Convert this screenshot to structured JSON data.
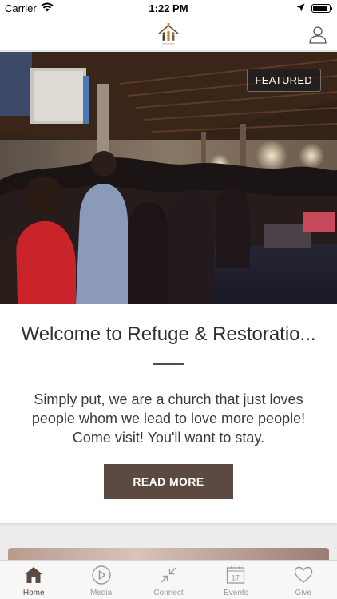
{
  "status_bar": {
    "carrier": "Carrier",
    "time": "1:22 PM",
    "battery_level": 0.9
  },
  "nav": {
    "logo_icon": "church-logo-icon",
    "profile_icon": "user-icon"
  },
  "featured": {
    "badge": "FEATURED",
    "title": "Welcome to Refuge & Restoratio...",
    "body": "Simply put, we are a church that just loves people whom we lead to love more people! Come visit! You'll want to stay.",
    "button_label": "READ MORE"
  },
  "tabs": [
    {
      "label": "Home",
      "icon": "home-icon",
      "active": true
    },
    {
      "label": "Media",
      "icon": "play-icon",
      "active": false
    },
    {
      "label": "Connect",
      "icon": "connect-arrows-icon",
      "active": false
    },
    {
      "label": "Events",
      "icon": "calendar-icon",
      "active": false,
      "date": "17"
    },
    {
      "label": "Give",
      "icon": "heart-icon",
      "active": false
    }
  ],
  "colors": {
    "accent": "#5c4a42",
    "inactive": "#9a9a9a"
  }
}
